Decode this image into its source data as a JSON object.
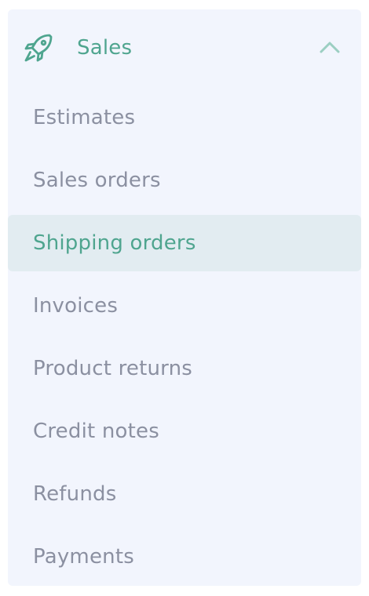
{
  "colors": {
    "accent": "#4fa58f",
    "panel_background": "#f2f5fd",
    "active_background": "#e2ecf1",
    "item_text": "#8b90a1"
  },
  "section": {
    "label": "Sales",
    "icon": "rocket-icon",
    "toggle_icon": "chevron-up-icon",
    "expanded": true
  },
  "menu": {
    "active_item": "Shipping orders",
    "items": [
      {
        "label": "Estimates"
      },
      {
        "label": "Sales orders"
      },
      {
        "label": "Shipping orders"
      },
      {
        "label": "Invoices"
      },
      {
        "label": "Product returns"
      },
      {
        "label": "Credit notes"
      },
      {
        "label": "Refunds"
      },
      {
        "label": "Payments"
      }
    ]
  }
}
